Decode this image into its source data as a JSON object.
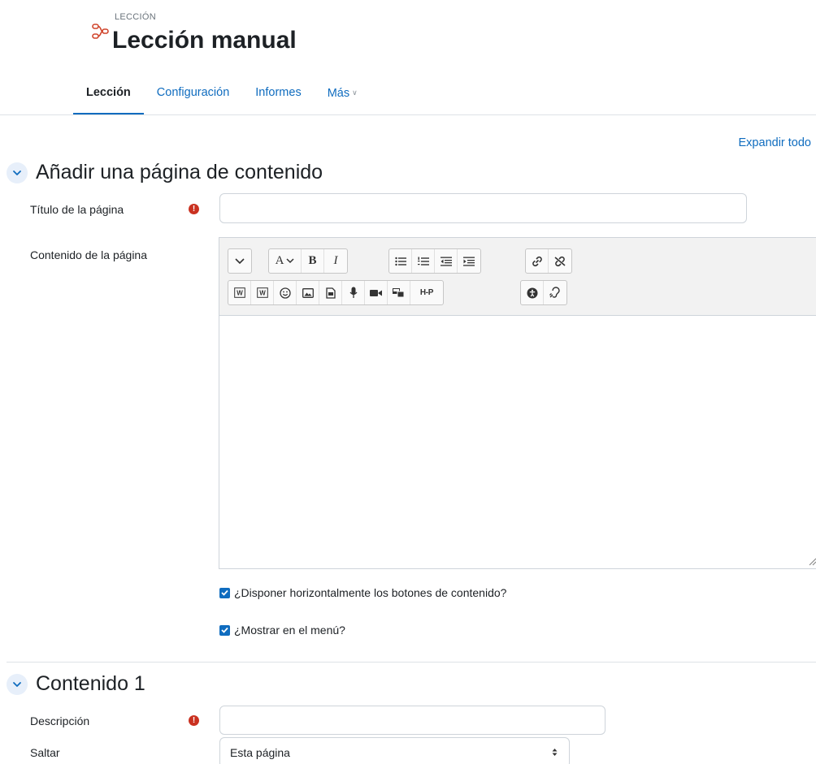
{
  "header": {
    "eyebrow": "LECCIÓN",
    "title": "Lección manual",
    "icon": "lesson-icon",
    "icon_color": "#d0442b"
  },
  "tabs": [
    {
      "label": "Lección",
      "active": true
    },
    {
      "label": "Configuración",
      "active": false
    },
    {
      "label": "Informes",
      "active": false
    },
    {
      "label": "Más",
      "active": false
    }
  ],
  "expand_all": "Expandir todo",
  "section1": {
    "title": "Añadir una página de contenido",
    "page_title_label": "Título de la página",
    "page_title_value": "",
    "page_content_label": "Contenido de la página",
    "checkbox_horizontal": "¿Disponer horizontalmente los botones de contenido?",
    "checkbox_horizontal_checked": true,
    "checkbox_menu": "¿Mostrar en el menú?",
    "checkbox_menu_checked": true
  },
  "editor": {
    "toolbar_row1": [
      "expand-toolbar-icon",
      "font-color-icon",
      "bold-icon",
      "italic-icon",
      "unordered-list-icon",
      "ordered-list-icon",
      "outdent-icon",
      "indent-icon",
      "link-icon",
      "unlink-icon"
    ],
    "toolbar_row2": [
      "word-import-icon",
      "word-paste-icon",
      "emoji-icon",
      "image-icon",
      "media-icon",
      "record-audio-icon",
      "record-video-icon",
      "manage-files-icon",
      "h5p-icon",
      "accessibility-checker-icon",
      "screen-reader-helper-icon"
    ],
    "bold_glyph": "B",
    "italic_glyph": "I",
    "font_glyph": "A",
    "h5p_glyph": "H-P",
    "word_glyph": "W"
  },
  "section2": {
    "title": "Contenido 1",
    "description_label": "Descripción",
    "description_value": "",
    "jump_label": "Saltar",
    "jump_value": "Esta página"
  },
  "colors": {
    "accent": "#0f6cbf",
    "required": "#ca3120",
    "text": "#1d2125"
  }
}
